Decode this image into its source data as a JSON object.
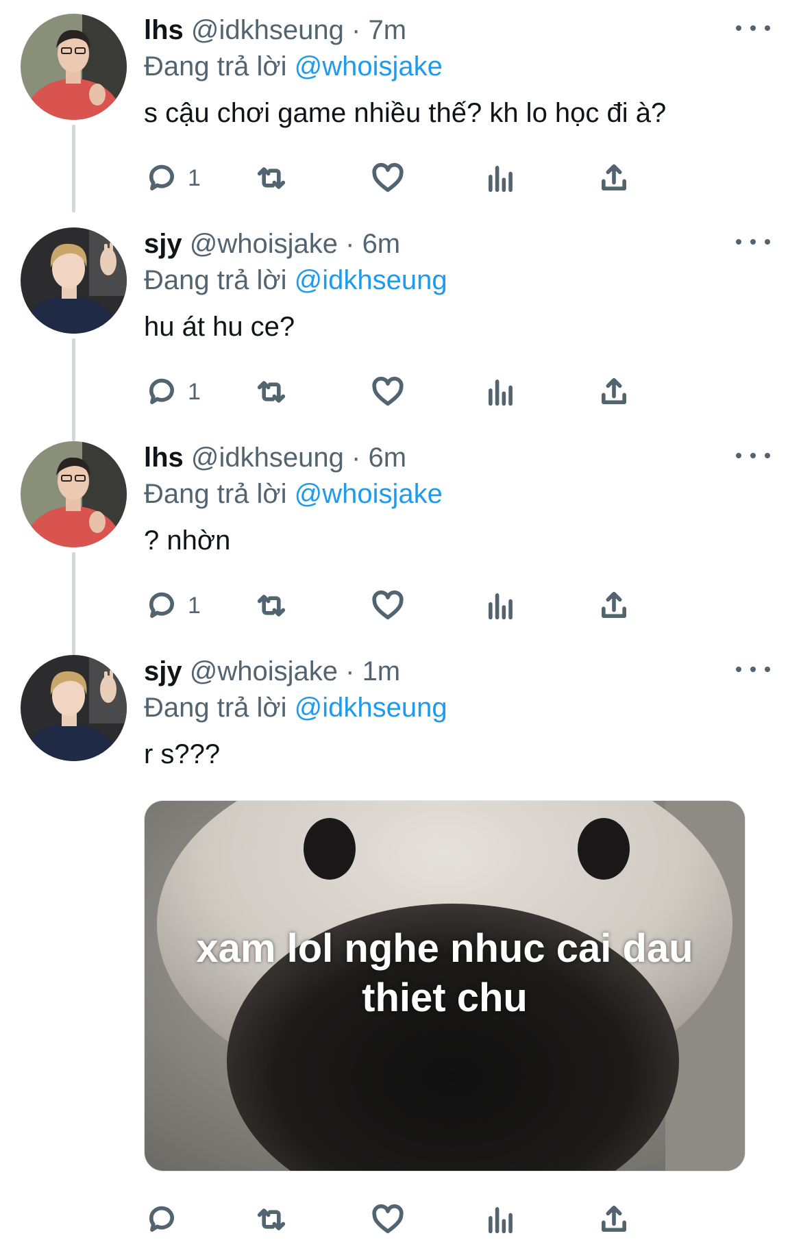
{
  "tweets": [
    {
      "name": "lhs",
      "handle": "@idkhseung",
      "time": "7m",
      "replying_prefix": "Đang trả lời",
      "replying_to": "@whoisjake",
      "text": "s cậu chơi game nhiều thế? kh lo học đi à?",
      "reply_count": "1",
      "avatar": "boy-red-sweater"
    },
    {
      "name": "sjy",
      "handle": "@whoisjake",
      "time": "6m",
      "replying_prefix": "Đang trả lời",
      "replying_to": "@idkhseung",
      "text": "hu át hu ce?",
      "reply_count": "1",
      "avatar": "boy-dark-hoodie"
    },
    {
      "name": "lhs",
      "handle": "@idkhseung",
      "time": "6m",
      "replying_prefix": "Đang trả lời",
      "replying_to": "@whoisjake",
      "text": "? nhờn",
      "reply_count": "1",
      "avatar": "boy-red-sweater"
    },
    {
      "name": "sjy",
      "handle": "@whoisjake",
      "time": "1m",
      "replying_prefix": "Đang trả lời",
      "replying_to": "@idkhseung",
      "text": "r s???",
      "reply_count": "",
      "avatar": "boy-dark-hoodie"
    }
  ],
  "separator": "·",
  "media": {
    "caption_line1": "xam lol nghe nhuc cai dau",
    "caption_line2": "thiet chu"
  },
  "icons": [
    "reply-icon",
    "retweet-icon",
    "like-icon",
    "views-icon",
    "share-icon",
    "more-icon"
  ],
  "colors": {
    "mention": "#1d9bf0",
    "secondary": "#536471",
    "thread_line": "#cfd9de"
  }
}
